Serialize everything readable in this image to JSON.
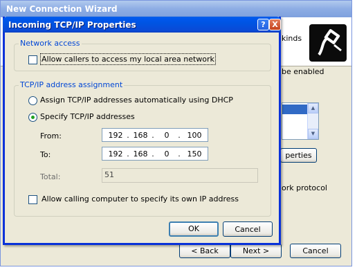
{
  "wizard": {
    "title": "New Connection Wizard",
    "header_text_fragment": "kinds",
    "text_enabled_fragment": "be enabled",
    "properties_fragment": "perties",
    "protocol_fragment": "ork protocol",
    "back_label": "< Back",
    "next_label": "Next >",
    "cancel_label": "Cancel"
  },
  "dialog": {
    "title": "Incoming TCP/IP Properties",
    "help_label": "?",
    "close_label": "X",
    "network_access": {
      "group_label": "Network access",
      "allow_lan_label": "Allow callers to access my local area network",
      "allow_lan_checked": false
    },
    "tcpip": {
      "group_label": "TCP/IP address assignment",
      "dhcp_label": "Assign TCP/IP addresses automatically using DHCP",
      "specify_label": "Specify TCP/IP addresses",
      "selected": "specify",
      "from_label": "From:",
      "from_octets": [
        "192",
        "168",
        "0",
        "100"
      ],
      "to_label": "To:",
      "to_octets": [
        "192",
        "168",
        "0",
        "150"
      ],
      "total_label": "Total:",
      "total_value": "51",
      "allow_own_ip_label": "Allow calling computer to specify its own IP address",
      "allow_own_ip_checked": false
    },
    "ok_label": "OK",
    "cancel_label": "Cancel"
  },
  "colors": {
    "dialog_border": "#0831d9",
    "group_label": "#0046d5",
    "radio_dot": "#21a121"
  }
}
